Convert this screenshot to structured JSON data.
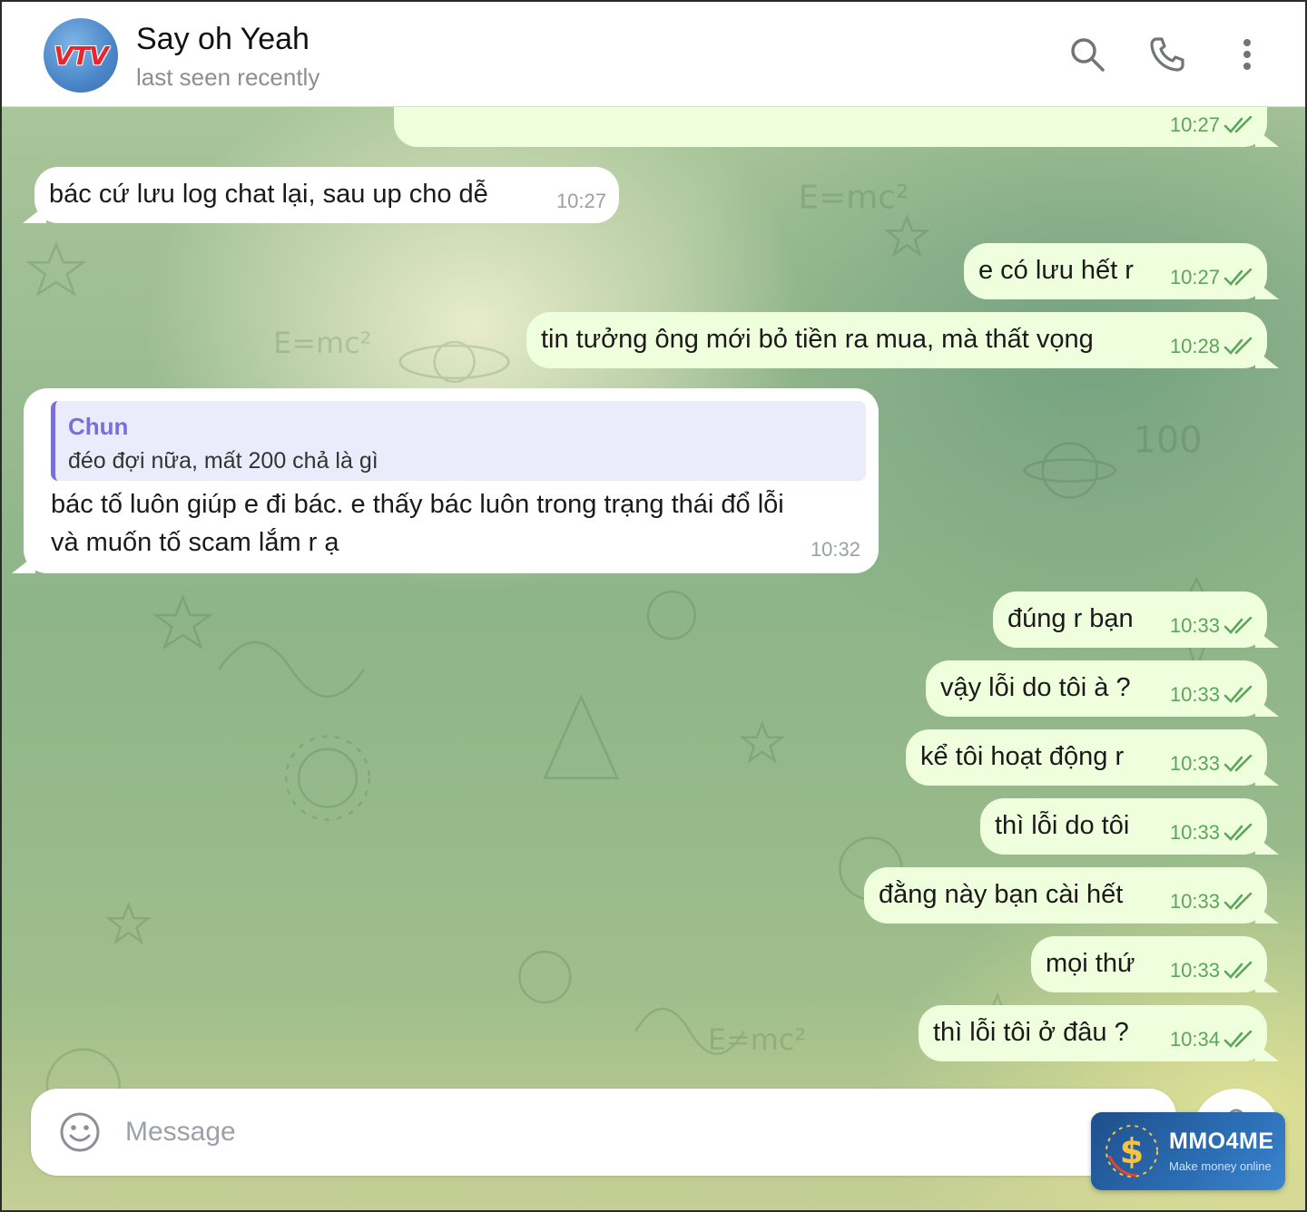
{
  "header": {
    "avatar_text": "VTV",
    "name": "Say oh Yeah",
    "status": "last seen recently",
    "icons": [
      "search-icon",
      "phone-icon",
      "more-vertical-icon"
    ]
  },
  "messages": [
    {
      "dir": "out",
      "text": "",
      "time": "10:27",
      "read": true
    },
    {
      "dir": "in",
      "text": "bác cứ lưu log chat lại, sau up cho dễ",
      "time": "10:27"
    },
    {
      "dir": "out",
      "text": "e có lưu hết r",
      "time": "10:27",
      "read": true
    },
    {
      "dir": "out",
      "text": "tin tưởng ông mới bỏ tiền ra mua, mà thất vọng",
      "time": "10:28",
      "read": true
    },
    {
      "dir": "in",
      "reply_name": "Chun",
      "reply_text": "đéo đợi nữa, mất 200 chả là gì",
      "text_line1": "bác tố luôn giúp e đi bác. e thấy bác luôn trong trạng thái đổ lỗi",
      "text_line2": "và muốn tố scam lắm r ạ",
      "time": "10:32"
    },
    {
      "dir": "out",
      "text": "đúng r bạn",
      "time": "10:33",
      "read": true
    },
    {
      "dir": "out",
      "text": "vậy lỗi do tôi à ?",
      "time": "10:33",
      "read": true
    },
    {
      "dir": "out",
      "text": "kể tôi hoạt động r",
      "time": "10:33",
      "read": true
    },
    {
      "dir": "out",
      "text": "thì lỗi do tôi",
      "time": "10:33",
      "read": true
    },
    {
      "dir": "out",
      "text": "đằng này bạn cài hết",
      "time": "10:33",
      "read": true
    },
    {
      "dir": "out",
      "text": "mọi thứ",
      "time": "10:33",
      "read": true
    },
    {
      "dir": "out",
      "text": "thì lỗi tôi ở đâu ?",
      "time": "10:34",
      "read": true
    }
  ],
  "composer": {
    "placeholder": "Message",
    "value": "",
    "icons": [
      "emoji-icon",
      "attach-icon",
      "mic-icon"
    ]
  },
  "watermark": {
    "title": "MMO4ME",
    "subtitle": "Make money online"
  },
  "colors": {
    "outgoing_bubble": "#effedd",
    "incoming_bubble": "#ffffff",
    "check_marks": "#5aa65a",
    "reply_accent": "#7a6fd6"
  }
}
